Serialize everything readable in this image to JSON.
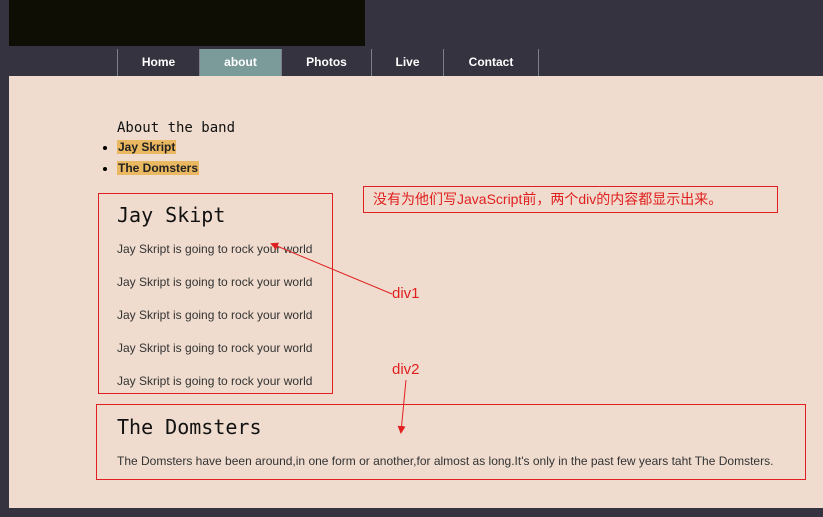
{
  "nav": {
    "items": [
      {
        "label": "Home"
      },
      {
        "label": "about"
      },
      {
        "label": "Photos"
      },
      {
        "label": "Live"
      },
      {
        "label": "Contact"
      }
    ]
  },
  "about": {
    "heading": "About the band",
    "bands": [
      "Jay Skript",
      "The Domsters"
    ]
  },
  "div1": {
    "title": "Jay Skipt",
    "lines": [
      "Jay Skript is going to rock your world",
      "Jay Skript is going to rock your world",
      "Jay Skript is going to rock your world",
      "Jay Skript is going to rock your world",
      "Jay Skript is going to rock your world"
    ]
  },
  "div2": {
    "title": "The Domsters",
    "text": "The Domsters have been around,in one form or another,for almost as long.It's only in the past few years taht The Domsters."
  },
  "annotations": {
    "note": "没有为他们写JavaScript前，两个div的内容都显示出来。",
    "div1_label": "div1",
    "div2_label": "div2",
    "color": "#e02020"
  },
  "colors": {
    "header_bg": "#34333f",
    "banner_bg": "#0f0e05",
    "content_bg": "#efdcce",
    "active_tab": "#7b9b9b",
    "highlight": "#eab861"
  }
}
